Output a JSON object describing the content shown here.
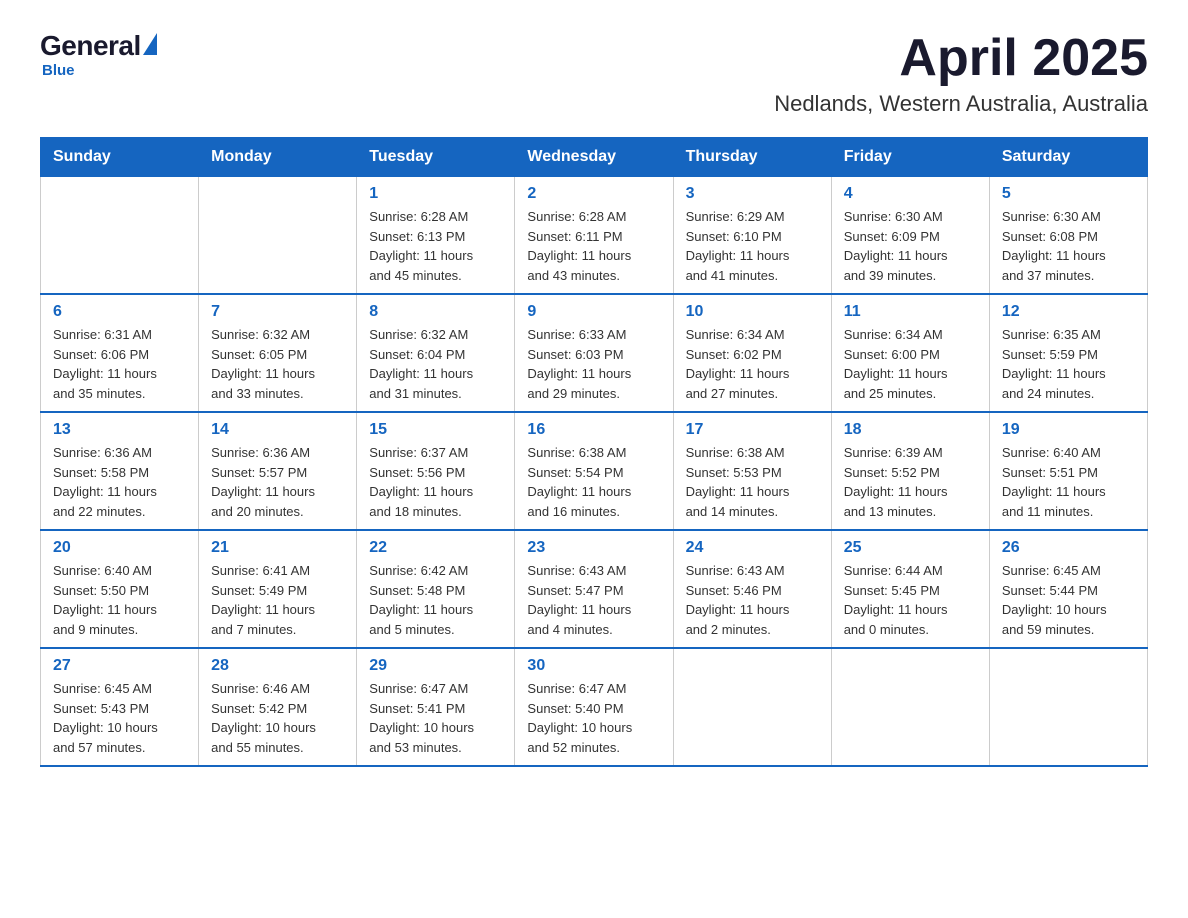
{
  "logo": {
    "general": "General",
    "blue": "Blue",
    "tagline": "Blue"
  },
  "title": "April 2025",
  "subtitle": "Nedlands, Western Australia, Australia",
  "weekdays": [
    "Sunday",
    "Monday",
    "Tuesday",
    "Wednesday",
    "Thursday",
    "Friday",
    "Saturday"
  ],
  "weeks": [
    [
      {
        "day": "",
        "info": ""
      },
      {
        "day": "",
        "info": ""
      },
      {
        "day": "1",
        "info": "Sunrise: 6:28 AM\nSunset: 6:13 PM\nDaylight: 11 hours\nand 45 minutes."
      },
      {
        "day": "2",
        "info": "Sunrise: 6:28 AM\nSunset: 6:11 PM\nDaylight: 11 hours\nand 43 minutes."
      },
      {
        "day": "3",
        "info": "Sunrise: 6:29 AM\nSunset: 6:10 PM\nDaylight: 11 hours\nand 41 minutes."
      },
      {
        "day": "4",
        "info": "Sunrise: 6:30 AM\nSunset: 6:09 PM\nDaylight: 11 hours\nand 39 minutes."
      },
      {
        "day": "5",
        "info": "Sunrise: 6:30 AM\nSunset: 6:08 PM\nDaylight: 11 hours\nand 37 minutes."
      }
    ],
    [
      {
        "day": "6",
        "info": "Sunrise: 6:31 AM\nSunset: 6:06 PM\nDaylight: 11 hours\nand 35 minutes."
      },
      {
        "day": "7",
        "info": "Sunrise: 6:32 AM\nSunset: 6:05 PM\nDaylight: 11 hours\nand 33 minutes."
      },
      {
        "day": "8",
        "info": "Sunrise: 6:32 AM\nSunset: 6:04 PM\nDaylight: 11 hours\nand 31 minutes."
      },
      {
        "day": "9",
        "info": "Sunrise: 6:33 AM\nSunset: 6:03 PM\nDaylight: 11 hours\nand 29 minutes."
      },
      {
        "day": "10",
        "info": "Sunrise: 6:34 AM\nSunset: 6:02 PM\nDaylight: 11 hours\nand 27 minutes."
      },
      {
        "day": "11",
        "info": "Sunrise: 6:34 AM\nSunset: 6:00 PM\nDaylight: 11 hours\nand 25 minutes."
      },
      {
        "day": "12",
        "info": "Sunrise: 6:35 AM\nSunset: 5:59 PM\nDaylight: 11 hours\nand 24 minutes."
      }
    ],
    [
      {
        "day": "13",
        "info": "Sunrise: 6:36 AM\nSunset: 5:58 PM\nDaylight: 11 hours\nand 22 minutes."
      },
      {
        "day": "14",
        "info": "Sunrise: 6:36 AM\nSunset: 5:57 PM\nDaylight: 11 hours\nand 20 minutes."
      },
      {
        "day": "15",
        "info": "Sunrise: 6:37 AM\nSunset: 5:56 PM\nDaylight: 11 hours\nand 18 minutes."
      },
      {
        "day": "16",
        "info": "Sunrise: 6:38 AM\nSunset: 5:54 PM\nDaylight: 11 hours\nand 16 minutes."
      },
      {
        "day": "17",
        "info": "Sunrise: 6:38 AM\nSunset: 5:53 PM\nDaylight: 11 hours\nand 14 minutes."
      },
      {
        "day": "18",
        "info": "Sunrise: 6:39 AM\nSunset: 5:52 PM\nDaylight: 11 hours\nand 13 minutes."
      },
      {
        "day": "19",
        "info": "Sunrise: 6:40 AM\nSunset: 5:51 PM\nDaylight: 11 hours\nand 11 minutes."
      }
    ],
    [
      {
        "day": "20",
        "info": "Sunrise: 6:40 AM\nSunset: 5:50 PM\nDaylight: 11 hours\nand 9 minutes."
      },
      {
        "day": "21",
        "info": "Sunrise: 6:41 AM\nSunset: 5:49 PM\nDaylight: 11 hours\nand 7 minutes."
      },
      {
        "day": "22",
        "info": "Sunrise: 6:42 AM\nSunset: 5:48 PM\nDaylight: 11 hours\nand 5 minutes."
      },
      {
        "day": "23",
        "info": "Sunrise: 6:43 AM\nSunset: 5:47 PM\nDaylight: 11 hours\nand 4 minutes."
      },
      {
        "day": "24",
        "info": "Sunrise: 6:43 AM\nSunset: 5:46 PM\nDaylight: 11 hours\nand 2 minutes."
      },
      {
        "day": "25",
        "info": "Sunrise: 6:44 AM\nSunset: 5:45 PM\nDaylight: 11 hours\nand 0 minutes."
      },
      {
        "day": "26",
        "info": "Sunrise: 6:45 AM\nSunset: 5:44 PM\nDaylight: 10 hours\nand 59 minutes."
      }
    ],
    [
      {
        "day": "27",
        "info": "Sunrise: 6:45 AM\nSunset: 5:43 PM\nDaylight: 10 hours\nand 57 minutes."
      },
      {
        "day": "28",
        "info": "Sunrise: 6:46 AM\nSunset: 5:42 PM\nDaylight: 10 hours\nand 55 minutes."
      },
      {
        "day": "29",
        "info": "Sunrise: 6:47 AM\nSunset: 5:41 PM\nDaylight: 10 hours\nand 53 minutes."
      },
      {
        "day": "30",
        "info": "Sunrise: 6:47 AM\nSunset: 5:40 PM\nDaylight: 10 hours\nand 52 minutes."
      },
      {
        "day": "",
        "info": ""
      },
      {
        "day": "",
        "info": ""
      },
      {
        "day": "",
        "info": ""
      }
    ]
  ]
}
